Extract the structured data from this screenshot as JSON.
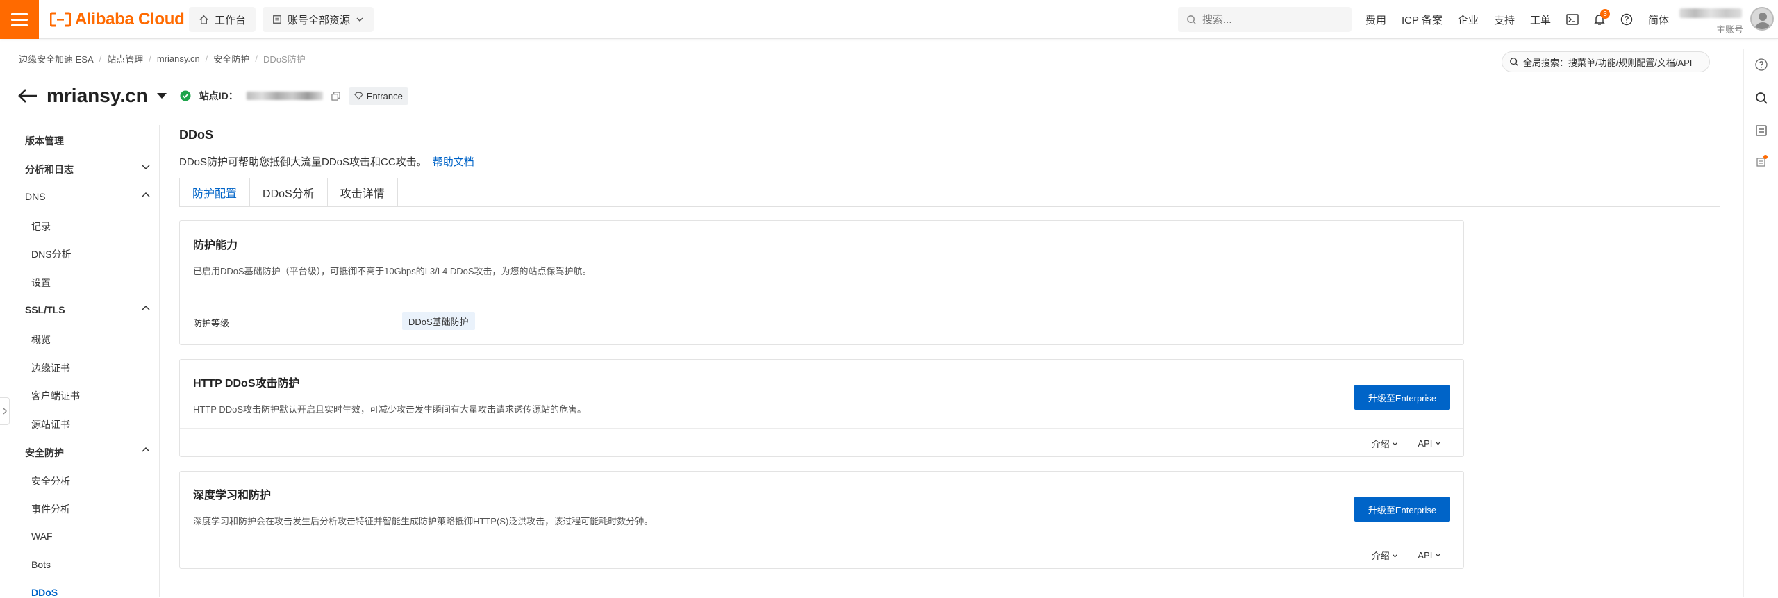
{
  "topbar": {
    "brand": "Alibaba Cloud",
    "workbench_label": "工作台",
    "resources_label": "账号全部资源",
    "search_placeholder": "搜索...",
    "links": [
      "费用",
      "ICP 备案",
      "企业",
      "支持",
      "工单"
    ],
    "notification_count": "3",
    "language": "简体",
    "account_sub": "主账号",
    "brand_color": "#ff6a00"
  },
  "breadcrumb": [
    "边缘安全加速 ESA",
    "站点管理",
    "mriansy.cn",
    "安全防护",
    "DDoS防护"
  ],
  "global_search": "全局搜索：搜菜单/功能/规则配置/文档/API",
  "site": {
    "name": "mriansy.cn",
    "id_label": "站点ID：",
    "entrance_label": "Entrance"
  },
  "sidebar": {
    "items": [
      {
        "label": "版本管理",
        "type": "group"
      },
      {
        "label": "分析和日志",
        "type": "group"
      },
      {
        "label": "DNS",
        "type": "group"
      },
      {
        "label": "记录",
        "type": "sub"
      },
      {
        "label": "DNS分析",
        "type": "sub"
      },
      {
        "label": "设置",
        "type": "sub"
      },
      {
        "label": "SSL/TLS",
        "type": "group"
      },
      {
        "label": "概览",
        "type": "sub"
      },
      {
        "label": "边缘证书",
        "type": "sub"
      },
      {
        "label": "客户端证书",
        "type": "sub"
      },
      {
        "label": "源站证书",
        "type": "sub"
      },
      {
        "label": "安全防护",
        "type": "group"
      },
      {
        "label": "安全分析",
        "type": "sub"
      },
      {
        "label": "事件分析",
        "type": "sub"
      },
      {
        "label": "WAF",
        "type": "sub"
      },
      {
        "label": "Bots",
        "type": "sub"
      },
      {
        "label": "DDoS",
        "type": "sub-active"
      }
    ]
  },
  "main": {
    "title": "DDoS",
    "description": "DDoS防护可帮助您抵御大流量DDoS攻击和CC攻击。",
    "help_link": "帮助文档",
    "tabs": [
      "防护配置",
      "DDoS分析",
      "攻击详情"
    ],
    "cards": [
      {
        "title": "防护能力",
        "description": "已启用DDoS基础防护（平台级），可抵御不高于10Gbps的L3/L4 DDoS攻击，为您的站点保驾护航。",
        "row_label": "防护等级",
        "row_value": "DDoS基础防护"
      },
      {
        "title": "HTTP DDoS攻击防护",
        "description": "HTTP DDoS攻击防护默认开启且实时生效，可减少攻击发生瞬间有大量攻击请求透传源站的危害。",
        "button": "升级至Enterprise",
        "footer": [
          "介绍",
          "API"
        ]
      },
      {
        "title": "深度学习和防护",
        "description": "深度学习和防护会在攻击发生后分析攻击特征并智能生成防护策略抵御HTTP(S)泛洪攻击，该过程可能耗时数分钟。",
        "button": "升级至Enterprise",
        "footer": [
          "介绍",
          "API"
        ]
      }
    ]
  },
  "accent_color": "#0064c8"
}
